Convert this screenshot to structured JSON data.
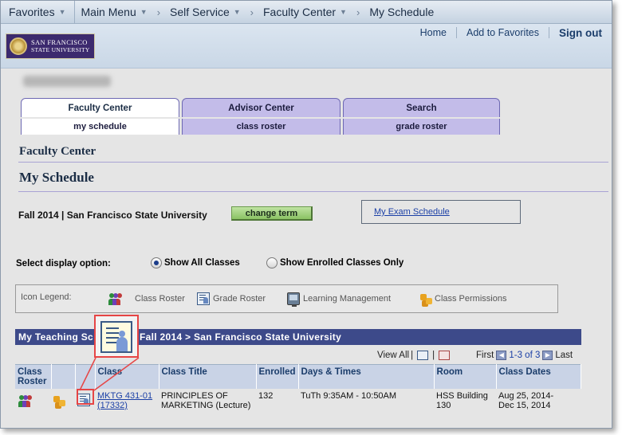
{
  "nav": {
    "favorites": "Favorites",
    "main_menu": "Main Menu",
    "self_service": "Self Service",
    "faculty_center": "Faculty Center",
    "current": "My Schedule"
  },
  "header": {
    "logo_line1": "San Francisco",
    "logo_line2": "State University",
    "home": "Home",
    "add_favorites": "Add to Favorites",
    "sign_out": "Sign out"
  },
  "tabs": {
    "row1": [
      "Faculty Center",
      "Advisor Center",
      "Search"
    ],
    "row2": [
      "my schedule",
      "class roster",
      "grade roster"
    ]
  },
  "section_title": "Faculty Center",
  "page_title": "My Schedule",
  "term": {
    "label": "Fall 2014 | San Francisco State University",
    "button": "change term"
  },
  "exam_schedule_link": "My Exam Schedule",
  "display": {
    "label": "Select display option:",
    "option_all": "Show All Classes",
    "option_enrolled": "Show Enrolled Classes Only",
    "selected": "Show All Classes"
  },
  "legend": {
    "label": "Icon Legend:",
    "class_roster": "Class Roster",
    "grade_roster": "Grade Roster",
    "learning_mgmt": "Learning Management",
    "class_permissions": "Class Permissions"
  },
  "teaching": {
    "title_left": "My Teaching Sc",
    "title_right": "Fall 2014 > San Francisco State University",
    "view_all": "View All",
    "first": "First",
    "range": "1-3 of 3",
    "last": "Last"
  },
  "table": {
    "headers": [
      "Class Roster",
      "",
      "",
      "Class",
      "Class Title",
      "Enrolled",
      "Days & Times",
      "Room",
      "Class Dates"
    ],
    "rows": [
      {
        "class": "MKTG 431-01 (17332)",
        "class_line1": "MKTG 431-01",
        "class_line2": "(17332)",
        "title": "PRINCIPLES OF MARKETING (Lecture)",
        "title_line1": "PRINCIPLES OF",
        "title_line2": "MARKETING (Lecture)",
        "enrolled": "132",
        "days_times": "TuTh 9:35AM - 10:50AM",
        "room_line1": "HSS Building",
        "room_line2": "130",
        "dates_line1": "Aug 25, 2014-",
        "dates_line2": "Dec 15, 2014"
      }
    ]
  }
}
